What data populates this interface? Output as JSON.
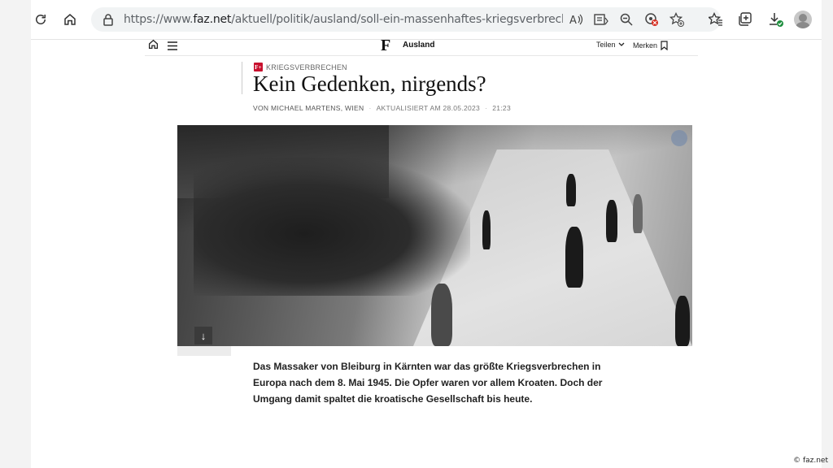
{
  "browser": {
    "url_prefix": "https://www.",
    "url_domain": "faz.net",
    "url_path": "/aktuell/politik/ausland/soll-ein-massenhaftes-kriegsverbrechen-vertuscht-we..."
  },
  "site": {
    "logo": "F",
    "section": "Ausland",
    "share_label": "Teilen",
    "bookmark_label": "Merken"
  },
  "article": {
    "plus_badge": "F+",
    "kicker": "KRIEGSVERBRECHEN",
    "headline": "Kein Gedenken, nirgends?",
    "byline_author": "VON MICHAEL MARTENS, WIEN",
    "byline_updated": "AKTUALISIERT AM 28.05.2023",
    "byline_time": "21:23",
    "teaser": "Das Massaker von Bleiburg in Kärnten war das größte Kriegsverbrechen in Europa nach dem 8. Mai 1945. Die Opfer waren vor allem Kroaten. Doch der Umgang damit spaltet die kroatische Gesellschaft bis heute."
  },
  "watermark": "© faz.net",
  "icons": {
    "reload": "reload-icon",
    "home": "home-icon",
    "lock": "lock-icon",
    "read_aloud": "read-aloud-icon",
    "reader": "reader-view-icon",
    "zoom": "zoom-icon",
    "tracking": "tracking-prevention-icon",
    "favorite": "add-favorite-icon",
    "favorites": "favorites-icon",
    "collections": "collections-icon",
    "downloads": "downloads-icon",
    "profile": "profile-icon"
  }
}
